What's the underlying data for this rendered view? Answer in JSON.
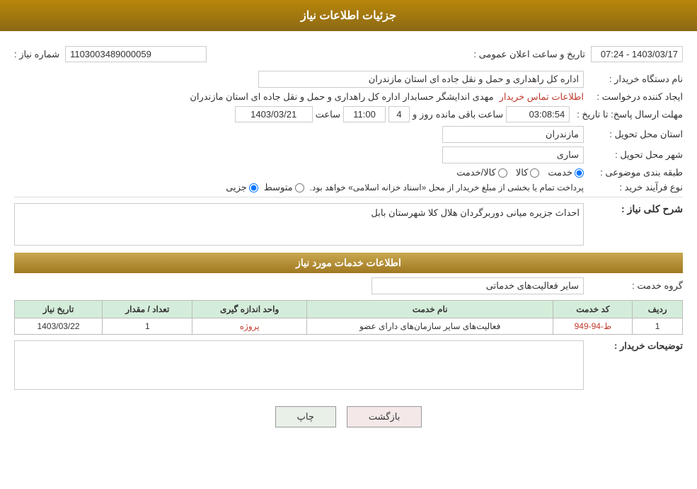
{
  "page": {
    "title": "جزئیات اطلاعات نیاز",
    "header": {
      "title": "جزئیات اطلاعات نیاز"
    },
    "fields": {
      "need_number_label": "شماره نیاز :",
      "need_number_value": "1103003489000059",
      "buyer_org_label": "نام دستگاه خریدار :",
      "buyer_org_value": "اداره کل راهداری و حمل و نقل جاده ای استان مازندران",
      "creator_label": "ایجاد کننده درخواست :",
      "creator_value": "مهدی اندایشگر حسابدار اداره کل راهداری و حمل و نقل جاده ای استان مازندران",
      "creator_link": "اطلاعات تماس خریدار",
      "announce_datetime_label": "تاریخ و ساعت اعلان عمومی :",
      "announce_datetime_value": "1403/03/17 - 07:24",
      "response_deadline_label": "مهلت ارسال پاسخ: تا تاریخ :",
      "response_date": "1403/03/21",
      "response_time_label": "ساعت",
      "response_time": "11:00",
      "response_days_label": "روز و",
      "response_days": "4",
      "response_remaining_label": "ساعت باقی مانده",
      "response_remaining": "03:08:54",
      "delivery_province_label": "استان محل تحویل :",
      "delivery_province": "مازندران",
      "delivery_city_label": "شهر محل تحویل :",
      "delivery_city": "ساری",
      "subject_label": "طبقه بندی موضوعی :",
      "subject_options": [
        "کالا",
        "خدمت",
        "کالا/خدمت"
      ],
      "subject_selected": "خدمت",
      "purchase_type_label": "نوع فرآیند خرید :",
      "purchase_types": [
        "جزیی",
        "متوسط"
      ],
      "purchase_notice": "پرداخت تمام یا بخشی از مبلغ خریدار از محل «اسناد خزانه اسلامی» خواهد بود.",
      "need_description_label": "شرح کلی نیاز :",
      "need_description_value": "احداث جزیره میانی دوربرگردان هلال کلا شهرستان بابل",
      "services_section_label": "اطلاعات خدمات مورد نیاز",
      "service_group_label": "گروه خدمت :",
      "service_group_value": "سایر فعالیت‌های خدماتی",
      "table": {
        "columns": [
          "ردیف",
          "کد خدمت",
          "نام خدمت",
          "واحد اندازه گیری",
          "تعداد / مقدار",
          "تاریخ نیاز"
        ],
        "rows": [
          {
            "row": "1",
            "code": "ط-94-949",
            "name": "فعالیت‌های سایر سازمان‌های دارای عضو",
            "unit": "پروژه",
            "quantity": "1",
            "date": "1403/03/22"
          }
        ]
      },
      "buyer_notes_label": "توضیحات خریدار :",
      "buyer_notes_value": "",
      "buttons": {
        "print": "چاپ",
        "back": "بازگشت"
      }
    }
  }
}
